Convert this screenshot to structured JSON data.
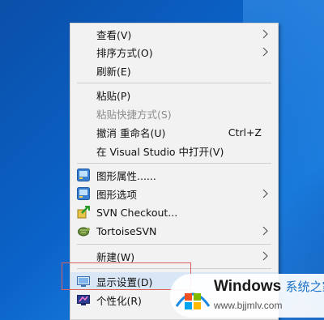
{
  "context_menu": {
    "items": [
      {
        "label": "查看(V)"
      },
      {
        "label": "排序方式(O)"
      },
      {
        "label": "刷新(E)"
      },
      {
        "label": "粘贴(P)"
      },
      {
        "label": "粘贴快捷方式(S)"
      },
      {
        "label": "撤消 重命名(U)",
        "shortcut": "Ctrl+Z"
      },
      {
        "label": "在 Visual Studio 中打开(V)"
      },
      {
        "label": "图形属性......"
      },
      {
        "label": "图形选项"
      },
      {
        "label": "SVN Checkout..."
      },
      {
        "label": "TortoiseSVN"
      },
      {
        "label": "新建(W)"
      },
      {
        "label": "显示设置(D)"
      },
      {
        "label": "个性化(R)"
      }
    ]
  },
  "watermark": {
    "title": "Windows",
    "suffix": "系统之家",
    "url": "www.bjjmlv.com"
  },
  "colors": {
    "desktop": "#0b63c9",
    "menu_bg": "#f2f2f2",
    "highlight_border": "#e06060"
  }
}
